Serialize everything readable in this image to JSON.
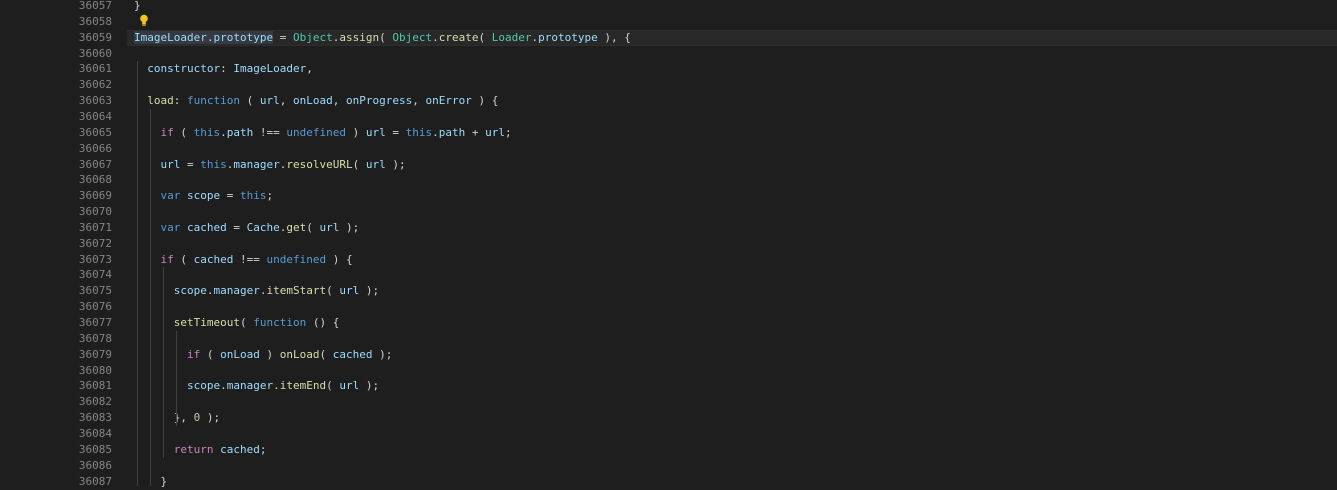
{
  "editor": {
    "line_numbers": [
      "36057",
      "36058",
      "36059",
      "36060",
      "36061",
      "36062",
      "36063",
      "36064",
      "36065",
      "36066",
      "36067",
      "36068",
      "36069",
      "36070",
      "36071",
      "36072",
      "36073",
      "36074",
      "36075",
      "36076",
      "36077",
      "36078",
      "36079",
      "36080",
      "36081",
      "36082",
      "36083",
      "36084",
      "36085",
      "36086",
      "36087"
    ],
    "current_line": "36059",
    "lines": [
      [
        {
          "t": "}",
          "c": "p"
        }
      ],
      [],
      [
        {
          "t": "ImageLoader",
          "c": "v hl2"
        },
        {
          "t": ".",
          "c": "p hl2"
        },
        {
          "t": "prototype",
          "c": "v hl2"
        },
        {
          "t": " = ",
          "c": "p"
        },
        {
          "t": "Object",
          "c": "t"
        },
        {
          "t": ".",
          "c": "p"
        },
        {
          "t": "assign",
          "c": "f"
        },
        {
          "t": "( ",
          "c": "p"
        },
        {
          "t": "Object",
          "c": "t"
        },
        {
          "t": ".",
          "c": "p"
        },
        {
          "t": "create",
          "c": "f"
        },
        {
          "t": "( ",
          "c": "p"
        },
        {
          "t": "Loader",
          "c": "t"
        },
        {
          "t": ".",
          "c": "p"
        },
        {
          "t": "prototype",
          "c": "v"
        },
        {
          "t": " ), {",
          "c": "p"
        }
      ],
      [],
      [
        {
          "t": "  ",
          "c": "p"
        },
        {
          "t": "constructor",
          "c": "v"
        },
        {
          "t": ": ",
          "c": "p"
        },
        {
          "t": "ImageLoader",
          "c": "v"
        },
        {
          "t": ",",
          "c": "p"
        }
      ],
      [],
      [
        {
          "t": "  ",
          "c": "p"
        },
        {
          "t": "load",
          "c": "f"
        },
        {
          "t": ": ",
          "c": "p"
        },
        {
          "t": "function",
          "c": "k"
        },
        {
          "t": " ( ",
          "c": "p"
        },
        {
          "t": "url",
          "c": "v"
        },
        {
          "t": ", ",
          "c": "p"
        },
        {
          "t": "onLoad",
          "c": "v"
        },
        {
          "t": ", ",
          "c": "p"
        },
        {
          "t": "onProgress",
          "c": "v"
        },
        {
          "t": ", ",
          "c": "p"
        },
        {
          "t": "onError",
          "c": "v"
        },
        {
          "t": " ) {",
          "c": "p"
        }
      ],
      [],
      [
        {
          "t": "    ",
          "c": "p"
        },
        {
          "t": "if",
          "c": "c"
        },
        {
          "t": " ( ",
          "c": "p"
        },
        {
          "t": "this",
          "c": "k"
        },
        {
          "t": ".",
          "c": "p"
        },
        {
          "t": "path",
          "c": "v"
        },
        {
          "t": " !== ",
          "c": "p"
        },
        {
          "t": "undefined",
          "c": "k"
        },
        {
          "t": " ) ",
          "c": "p"
        },
        {
          "t": "url",
          "c": "v"
        },
        {
          "t": " = ",
          "c": "p"
        },
        {
          "t": "this",
          "c": "k"
        },
        {
          "t": ".",
          "c": "p"
        },
        {
          "t": "path",
          "c": "v"
        },
        {
          "t": " + ",
          "c": "p"
        },
        {
          "t": "url",
          "c": "v"
        },
        {
          "t": ";",
          "c": "p"
        }
      ],
      [],
      [
        {
          "t": "    ",
          "c": "p"
        },
        {
          "t": "url",
          "c": "v"
        },
        {
          "t": " = ",
          "c": "p"
        },
        {
          "t": "this",
          "c": "k"
        },
        {
          "t": ".",
          "c": "p"
        },
        {
          "t": "manager",
          "c": "v"
        },
        {
          "t": ".",
          "c": "p"
        },
        {
          "t": "resolveURL",
          "c": "f"
        },
        {
          "t": "( ",
          "c": "p"
        },
        {
          "t": "url",
          "c": "v"
        },
        {
          "t": " );",
          "c": "p"
        }
      ],
      [],
      [
        {
          "t": "    ",
          "c": "p"
        },
        {
          "t": "var",
          "c": "k"
        },
        {
          "t": " ",
          "c": "p"
        },
        {
          "t": "scope",
          "c": "v"
        },
        {
          "t": " = ",
          "c": "p"
        },
        {
          "t": "this",
          "c": "k"
        },
        {
          "t": ";",
          "c": "p"
        }
      ],
      [],
      [
        {
          "t": "    ",
          "c": "p"
        },
        {
          "t": "var",
          "c": "k"
        },
        {
          "t": " ",
          "c": "p"
        },
        {
          "t": "cached",
          "c": "v"
        },
        {
          "t": " = ",
          "c": "p"
        },
        {
          "t": "Cache",
          "c": "v"
        },
        {
          "t": ".",
          "c": "p"
        },
        {
          "t": "get",
          "c": "f"
        },
        {
          "t": "( ",
          "c": "p"
        },
        {
          "t": "url",
          "c": "v"
        },
        {
          "t": " );",
          "c": "p"
        }
      ],
      [],
      [
        {
          "t": "    ",
          "c": "p"
        },
        {
          "t": "if",
          "c": "c"
        },
        {
          "t": " ( ",
          "c": "p"
        },
        {
          "t": "cached",
          "c": "v"
        },
        {
          "t": " !== ",
          "c": "p"
        },
        {
          "t": "undefined",
          "c": "k"
        },
        {
          "t": " ) {",
          "c": "p"
        }
      ],
      [],
      [
        {
          "t": "      ",
          "c": "p"
        },
        {
          "t": "scope",
          "c": "v"
        },
        {
          "t": ".",
          "c": "p"
        },
        {
          "t": "manager",
          "c": "v"
        },
        {
          "t": ".",
          "c": "p"
        },
        {
          "t": "itemStart",
          "c": "f"
        },
        {
          "t": "( ",
          "c": "p"
        },
        {
          "t": "url",
          "c": "v"
        },
        {
          "t": " );",
          "c": "p"
        }
      ],
      [],
      [
        {
          "t": "      ",
          "c": "p"
        },
        {
          "t": "setTimeout",
          "c": "f"
        },
        {
          "t": "( ",
          "c": "p"
        },
        {
          "t": "function",
          "c": "k"
        },
        {
          "t": " () {",
          "c": "p"
        }
      ],
      [],
      [
        {
          "t": "        ",
          "c": "p"
        },
        {
          "t": "if",
          "c": "c"
        },
        {
          "t": " ( ",
          "c": "p"
        },
        {
          "t": "onLoad",
          "c": "v"
        },
        {
          "t": " ) ",
          "c": "p"
        },
        {
          "t": "onLoad",
          "c": "f"
        },
        {
          "t": "( ",
          "c": "p"
        },
        {
          "t": "cached",
          "c": "v"
        },
        {
          "t": " );",
          "c": "p"
        }
      ],
      [],
      [
        {
          "t": "        ",
          "c": "p"
        },
        {
          "t": "scope",
          "c": "v"
        },
        {
          "t": ".",
          "c": "p"
        },
        {
          "t": "manager",
          "c": "v"
        },
        {
          "t": ".",
          "c": "p"
        },
        {
          "t": "itemEnd",
          "c": "f"
        },
        {
          "t": "( ",
          "c": "p"
        },
        {
          "t": "url",
          "c": "v"
        },
        {
          "t": " );",
          "c": "p"
        }
      ],
      [],
      [
        {
          "t": "      }, ",
          "c": "p"
        },
        {
          "t": "0",
          "c": "n"
        },
        {
          "t": " );",
          "c": "p"
        }
      ],
      [],
      [
        {
          "t": "      ",
          "c": "p"
        },
        {
          "t": "return",
          "c": "c"
        },
        {
          "t": " ",
          "c": "p"
        },
        {
          "t": "cached",
          "c": "v"
        },
        {
          "t": ";",
          "c": "p"
        }
      ],
      [],
      [
        {
          "t": "    }",
          "c": "p"
        }
      ]
    ]
  },
  "lightbulb_icon": "lightbulb-icon",
  "colors": {
    "background": "#1e1e1e",
    "line_number": "#858585",
    "keyword": "#569cd6",
    "control": "#c586c0",
    "variable": "#9cdcfe",
    "type": "#4ec9b0",
    "function": "#dcdcaa",
    "number": "#b5cea8"
  }
}
